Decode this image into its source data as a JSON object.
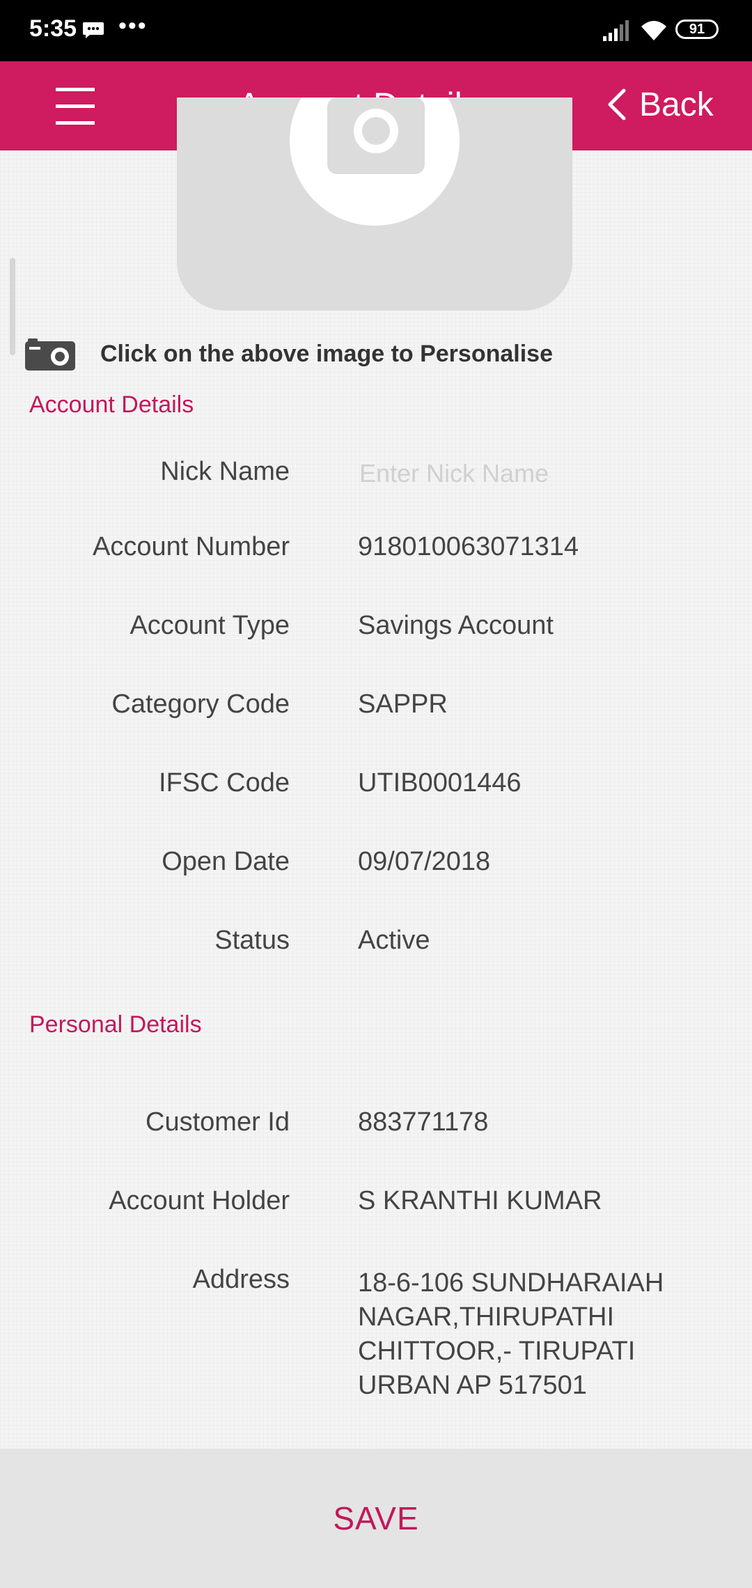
{
  "status_bar": {
    "time": "5:35",
    "dots": "•••",
    "battery": "91"
  },
  "header": {
    "title": "Account Details",
    "back_label": "Back"
  },
  "personalise": {
    "text": "Click on the above image to Personalise"
  },
  "account_section": {
    "title": "Account Details",
    "nick_name_label": "Nick Name",
    "nick_name_placeholder": "Enter Nick Name",
    "nick_name_value": "",
    "fields": [
      {
        "label": "Account Number",
        "value": "918010063071314"
      },
      {
        "label": "Account Type",
        "value": "Savings Account"
      },
      {
        "label": "Category Code",
        "value": "SAPPR"
      },
      {
        "label": "IFSC Code",
        "value": "UTIB0001446"
      },
      {
        "label": "Open Date",
        "value": "09/07/2018"
      },
      {
        "label": "Status",
        "value": "Active"
      }
    ]
  },
  "personal_section": {
    "title": "Personal Details",
    "fields": [
      {
        "label": "Customer Id",
        "value": "883771178"
      },
      {
        "label": "Account Holder",
        "value": "S KRANTHI KUMAR"
      }
    ],
    "address_label": "Address",
    "address_lines": [
      "18-6-106 SUNDHARAIAH",
      "NAGAR,THIRUPATHI",
      "CHITTOOR,- TIRUPATI",
      "URBAN AP 517501"
    ]
  },
  "footer": {
    "save_label": "SAVE"
  },
  "colors": {
    "brand": "#cf1b5f",
    "section_title": "#c2185b",
    "status_bar": "#000000",
    "save_bar": "#e4e4e4"
  }
}
